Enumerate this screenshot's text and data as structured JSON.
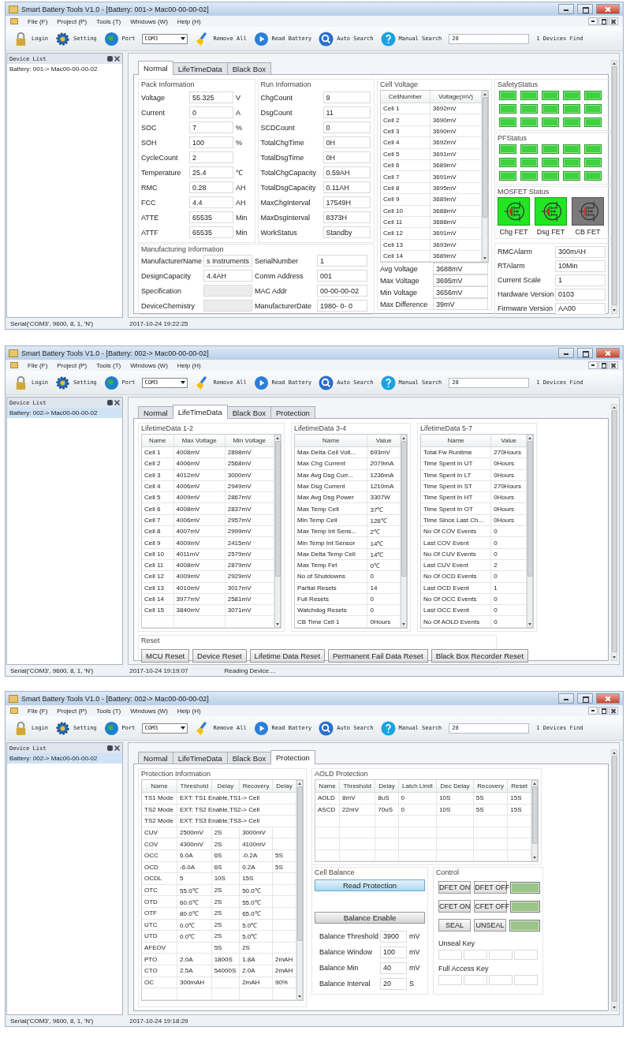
{
  "windows": [
    {
      "title": "Smart Battery Tools V1.0 - [Battery: 001-> Mac00-00-00-02]",
      "menu": [
        "File (F)",
        "Project (P)",
        "Tools (T)",
        "Windows (W)",
        "Help (H)"
      ],
      "toolbar": [
        {
          "kind": "button",
          "label": "Login"
        },
        {
          "kind": "button",
          "label": "Setting"
        },
        {
          "kind": "button",
          "label": "Port"
        },
        {
          "kind": "combo",
          "value": "COM3"
        },
        {
          "kind": "button",
          "label": "Remove All"
        },
        {
          "kind": "button",
          "label": "Read Battery"
        },
        {
          "kind": "button",
          "label": "Auto Search"
        },
        {
          "kind": "button",
          "label": "Manual Search"
        },
        {
          "kind": "field",
          "value": "28"
        },
        {
          "kind": "text",
          "label": "1 Devices Find"
        }
      ],
      "device_list": {
        "title": "Device List",
        "items": [
          {
            "label": "Battery: 001-> Mac00-00-00-02",
            "selected": false
          }
        ]
      },
      "tabs": [
        {
          "label": "Normal",
          "selected": true
        },
        {
          "label": "LifeTimeData",
          "selected": false
        },
        {
          "label": "Black Box",
          "selected": false
        }
      ],
      "page": {
        "kind": "normal",
        "pack_information": {
          "title": "Pack Information",
          "rows": [
            {
              "label": "Voltage",
              "value": "55.325",
              "unit": "V"
            },
            {
              "label": "Current",
              "value": "0",
              "unit": "A"
            },
            {
              "label": "SOC",
              "value": "7",
              "unit": "%"
            },
            {
              "label": "SOH",
              "value": "100",
              "unit": "%"
            },
            {
              "label": "CycleCount",
              "value": "2"
            },
            {
              "label": "Temperature",
              "value": "25.4",
              "unit": "℃"
            },
            {
              "label": "RMC",
              "value": "0.28",
              "unit": "AH"
            },
            {
              "label": "FCC",
              "value": "4.4",
              "unit": "AH"
            },
            {
              "label": "ATTE",
              "value": "65535",
              "unit": "Min"
            },
            {
              "label": "ATTF",
              "value": "65535",
              "unit": "Min"
            }
          ]
        },
        "run_information": {
          "title": "Run Information",
          "rows": [
            {
              "label": "ChgCount",
              "value": "9"
            },
            {
              "label": "DsgCount",
              "value": "11"
            },
            {
              "label": "SCDCount",
              "value": "0"
            },
            {
              "label": "TotalChgTime",
              "value": "0H"
            },
            {
              "label": "TotalDsgTime",
              "value": "0H"
            },
            {
              "label": "TotalChgCapacity",
              "value": "0.59AH"
            },
            {
              "label": "TotalDsgCapacity",
              "value": "0.11AH"
            },
            {
              "label": "MaxChgInterval",
              "value": "17549H"
            },
            {
              "label": "MaxDsgInterval",
              "value": "8373H"
            },
            {
              "label": "WorkStatus",
              "value": "Standby"
            }
          ]
        },
        "manufacturing_information": {
          "title": "Manufacturing Information",
          "rows": [
            {
              "left": {
                "label": "ManufacturerName",
                "value": "s Instruments",
                "disabled": false
              },
              "right": {
                "label": "SerialNumber",
                "value": "1",
                "disabled": false
              }
            },
            {
              "left": {
                "label": "DesignCapacity",
                "value": "4.4AH",
                "disabled": false
              },
              "right": {
                "label": "Comm Address",
                "value": "001",
                "disabled": false
              }
            },
            {
              "left": {
                "label": "Specification",
                "disabled": true
              },
              "right": {
                "label": "MAC Addr",
                "value": "00-00-00-02",
                "disabled": false
              }
            },
            {
              "left": {
                "label": "DeviceChemistry",
                "disabled": true
              },
              "right": {
                "label": "ManufacturerDate",
                "value": "1980- 0- 0",
                "disabled": false
              }
            }
          ]
        },
        "cell_voltage": {
          "title": "Cell Voltage",
          "columns": [
            "CellNumber",
            "Voltage(mV)"
          ],
          "rows": [
            [
              "Cell 1",
              "3692mV"
            ],
            [
              "Cell 2",
              "3690mV"
            ],
            [
              "Cell 3",
              "3690mV"
            ],
            [
              "Cell 4",
              "3692mV"
            ],
            [
              "Cell 5",
              "3691mV"
            ],
            [
              "Cell 6",
              "3689mV"
            ],
            [
              "Cell 7",
              "3691mV"
            ],
            [
              "Cell 8",
              "3695mV"
            ],
            [
              "Cell 9",
              "3689mV"
            ],
            [
              "Cell 10",
              "3688mV"
            ],
            [
              "Cell 11",
              "3688mV"
            ],
            [
              "Cell 12",
              "3691mV"
            ],
            [
              "Cell 13",
              "3693mV"
            ],
            [
              "Cell 14",
              "3689mV"
            ]
          ],
          "summary": [
            {
              "label": "Avg Voltage",
              "value": "3688mV"
            },
            {
              "label": "Max Voltage",
              "value": "3695mV"
            },
            {
              "label": "Min Voltage",
              "value": "3656mV"
            },
            {
              "label": "Max Difference",
              "value": "39mV"
            }
          ]
        },
        "safety_status": {
          "title": "SafetyStatus",
          "indicators": [
            {
              "on": true
            },
            {
              "on": true
            },
            {
              "on": true
            },
            {
              "on": true
            },
            {
              "on": true
            },
            {
              "on": true
            },
            {
              "on": true
            },
            {
              "on": true
            },
            {
              "on": true
            },
            {
              "on": true
            },
            {
              "on": true
            },
            {
              "on": true
            },
            {
              "on": true
            },
            {
              "on": true
            },
            {
              "on": true
            }
          ]
        },
        "pf_status": {
          "title": "PFStatus",
          "indicators": [
            {
              "on": true
            },
            {
              "on": true
            },
            {
              "on": true
            },
            {
              "on": true
            },
            {
              "on": true
            },
            {
              "on": true
            },
            {
              "on": true
            },
            {
              "on": true
            },
            {
              "on": true
            },
            {
              "on": true
            },
            {
              "on": true
            },
            {
              "on": true
            },
            {
              "on": true
            },
            {
              "on": true
            },
            {
              "on": true
            }
          ]
        },
        "mosfet_status": {
          "title": "MOSFET Status",
          "fets": [
            {
              "label": "Chg FET",
              "on": true
            },
            {
              "label": "Dsg FET",
              "on": true
            },
            {
              "label": "CB FET",
              "on": false
            }
          ]
        },
        "alarms": [
          {
            "label": "RMCAlarm",
            "value": "300mAH"
          },
          {
            "label": "RTAlarm",
            "value": "10Min"
          },
          {
            "label": "Current Scale",
            "value": "1"
          },
          {
            "label": "Hardware Version",
            "value": "0103"
          },
          {
            "label": "Firmware Version",
            "value": "AA00"
          }
        ]
      },
      "status_bar": [
        "Serial('COM3', 9600, 8, 1, 'N')",
        "2017-10-24 19:22:25"
      ]
    },
    {
      "title": "Smart Battery Tools V1.0 - [Battery: 002-> Mac00-00-00-02]",
      "menu": [
        "File (F)",
        "Project (P)",
        "Tools (T)",
        "Windows (W)",
        "Help (H)"
      ],
      "toolbar": [
        {
          "kind": "button",
          "label": "Login"
        },
        {
          "kind": "button",
          "label": "Setting"
        },
        {
          "kind": "button",
          "label": "Port"
        },
        {
          "kind": "combo",
          "value": "COM3"
        },
        {
          "kind": "button",
          "label": "Remove All"
        },
        {
          "kind": "button",
          "label": "Read Battery"
        },
        {
          "kind": "button",
          "label": "Auto Search"
        },
        {
          "kind": "button",
          "label": "Manual Search"
        },
        {
          "kind": "field",
          "value": "28"
        },
        {
          "kind": "text",
          "label": "1 Devices Find"
        }
      ],
      "device_list": {
        "title": "Device List",
        "items": [
          {
            "label": "Battery: 002-> Mac00-00-00-02",
            "selected": true
          }
        ]
      },
      "tabs": [
        {
          "label": "Normal",
          "selected": false
        },
        {
          "label": "LifeTimeData",
          "selected": true
        },
        {
          "label": "Black Box",
          "selected": false
        },
        {
          "label": "Protection",
          "selected": false
        }
      ],
      "page": {
        "kind": "lifetime",
        "tables": [
          {
            "title": "LifetimeData 1-2",
            "columns": [
              "Name",
              "Max Voltage",
              "Min Voltage"
            ],
            "rows": [
              [
                "Cell 1",
                "4008mV",
                "2898mV"
              ],
              [
                "Cell 2",
                "4006mV",
                "2568mV"
              ],
              [
                "Cell 3",
                "4012mV",
                "3000mV"
              ],
              [
                "Cell 4",
                "4006mV",
                "2949mV"
              ],
              [
                "Cell 5",
                "4009mV",
                "2867mV"
              ],
              [
                "Cell 6",
                "4008mV",
                "2837mV"
              ],
              [
                "Cell 7",
                "4006mV",
                "2957mV"
              ],
              [
                "Cell 8",
                "4007mV",
                "2999mV"
              ],
              [
                "Cell 9",
                "4009mV",
                "2415mV"
              ],
              [
                "Cell 10",
                "4011mV",
                "2579mV"
              ],
              [
                "Cell 11",
                "4008mV",
                "2879mV"
              ],
              [
                "Cell 12",
                "4009mV",
                "2929mV"
              ],
              [
                "Cell 13",
                "4010mV",
                "3017mV"
              ],
              [
                "Cell 14",
                "3977mV",
                "2581mV"
              ],
              [
                "Cell 15",
                "3840mV",
                "3071mV"
              ]
            ]
          },
          {
            "title": "LifetimeData 3-4",
            "columns": [
              "Name",
              "Value"
            ],
            "rows": [
              [
                "Max Delta Cell Volt...",
                "693mV"
              ],
              [
                "Max Chg Current",
                "2079mA"
              ],
              [
                "Max Avg Dsg Curr...",
                "1236mA"
              ],
              [
                "Max Dsg Current",
                "1210mA"
              ],
              [
                "Max Avg Dsg Power",
                "3307W"
              ],
              [
                "Max Temp Cell",
                "37℃"
              ],
              [
                "Min Temp Cell",
                "128℃"
              ],
              [
                "Max Temp Int Sens...",
                "2℃"
              ],
              [
                "Min Temp Int Sensor",
                "14℃"
              ],
              [
                "Max Delta Temp Cell",
                "14℃"
              ],
              [
                "Max Temp Fet",
                "0℃"
              ],
              [
                "No of Shutdowns",
                "0"
              ],
              [
                "Partial Resets",
                "14"
              ],
              [
                "Full Resets",
                "0"
              ],
              [
                "Watchdog Resets",
                "0"
              ],
              [
                "CB Time Cell 1",
                "0Hours"
              ]
            ]
          },
          {
            "title": "LifetimeData 5-7",
            "columns": [
              "Name",
              "Value"
            ],
            "rows": [
              [
                "Total Fw Runtime",
                "270Hours"
              ],
              [
                "Time Spent In UT",
                "0Hours"
              ],
              [
                "Time Spent In LT",
                "0Hours"
              ],
              [
                "Time Spent In ST",
                "270Hours"
              ],
              [
                "Time Spent In HT",
                "0Hours"
              ],
              [
                "Time Spent In OT",
                "0Hours"
              ],
              [
                "Time Since Last Ch...",
                "0Hours"
              ],
              [
                "No Of COV Events",
                "0"
              ],
              [
                "Last COV Event",
                "0"
              ],
              [
                "No Of CUV Events",
                "0"
              ],
              [
                "Last CUV Event",
                "2"
              ],
              [
                "No Of OCD Events",
                "0"
              ],
              [
                "Last OCD Event",
                "1"
              ],
              [
                "No Of OCC Events",
                "0"
              ],
              [
                "Last OCC Event",
                "0"
              ],
              [
                "No Of AOLD Events",
                "0"
              ]
            ]
          }
        ],
        "reset": {
          "title": "Reset",
          "buttons": [
            "MCU Reset",
            "Device Reset",
            "Lifetime Data Reset",
            "Permanent Fail Data Reset",
            "Black Box Recorder Reset"
          ]
        }
      },
      "status_bar": [
        "Serial('COM3', 9600, 8, 1, 'N')",
        "2017-10-24 19:19:07",
        "Reading Device...."
      ]
    },
    {
      "title": "Smart Battery Tools V1.0 - [Battery: 002-> Mac00-00-00-02]",
      "menu": [
        "File (F)",
        "Project (P)",
        "Tools (T)",
        "Windows (W)",
        "Help (H)"
      ],
      "toolbar": [
        {
          "kind": "button",
          "label": "Login"
        },
        {
          "kind": "button",
          "label": "Setting"
        },
        {
          "kind": "button",
          "label": "Port"
        },
        {
          "kind": "combo",
          "value": "COM3"
        },
        {
          "kind": "button",
          "label": "Remove All"
        },
        {
          "kind": "button",
          "label": "Read Battery"
        },
        {
          "kind": "button",
          "label": "Auto Search"
        },
        {
          "kind": "button",
          "label": "Manual Search"
        },
        {
          "kind": "field",
          "value": "28"
        },
        {
          "kind": "text",
          "label": "1 Devices Find"
        }
      ],
      "device_list": {
        "title": "Device List",
        "items": [
          {
            "label": "Battery: 002-> Mac00-00-00-02",
            "selected": true
          }
        ]
      },
      "tabs": [
        {
          "label": "Normal",
          "selected": false
        },
        {
          "label": "LifeTimeData",
          "selected": false
        },
        {
          "label": "Black Box",
          "selected": false
        },
        {
          "label": "Protection",
          "selected": true
        }
      ],
      "page": {
        "kind": "protection",
        "protection_information": {
          "title": "Protection Information",
          "columns": [
            "Name",
            "Threshold",
            "Delay",
            "Recovery",
            "Delay"
          ],
          "rows": [
            [
              "TS1 Mode",
              {
                "text": "EXT: TS1 Enable,TS1-> Cell",
                "colspan": 4
              }
            ],
            [
              "TS2 Mode",
              {
                "text": "EXT: TS2 Enable,TS2-> Cell",
                "colspan": 4
              }
            ],
            [
              "TS2 Mode",
              {
                "text": "EXT: TS3 Enable,TS3-> Cell",
                "colspan": 4
              }
            ],
            [
              "CUV",
              "2500mV",
              "2S",
              "3000mV",
              null
            ],
            [
              "COV",
              "4300mV",
              "2S",
              "4100mV",
              null
            ],
            [
              "OCC",
              "6.0A",
              "6S",
              "-0.2A",
              "5S"
            ],
            [
              "OCD",
              "-6.0A",
              "6S",
              "0.2A",
              "5S"
            ],
            [
              "OCDL",
              "5",
              "10S",
              "15S",
              null
            ],
            [
              "OTC",
              "55.0℃",
              "2S",
              "50.0℃",
              null
            ],
            [
              "OTD",
              "60.0℃",
              "2S",
              "55.0℃",
              null
            ],
            [
              "OTF",
              "80.0℃",
              "2S",
              "65.0℃",
              null
            ],
            [
              "UTC",
              "0.0℃",
              "2S",
              "5.0℃",
              null
            ],
            [
              "UTD",
              "0.0℃",
              "2S",
              "5.0℃",
              null
            ],
            [
              "AFEOV",
              null,
              "5S",
              "2S",
              null
            ],
            [
              "PTO",
              "2.0A",
              "1800S",
              "1.8A",
              "2mAH"
            ],
            [
              "CTO",
              "2.5A",
              "54000S",
              "2.0A",
              "2mAH"
            ],
            [
              "OC",
              "300mAH",
              null,
              "2mAH",
              "90%"
            ]
          ]
        },
        "aold_protection": {
          "title": "AOLD Protection",
          "columns": [
            "Name",
            "Threshold",
            "Delay",
            "Latch Limit",
            "Dec Delay",
            "Recovery",
            "Reset"
          ],
          "rows": [
            [
              "AOLD",
              "8mV",
              "8uS",
              "0",
              "10S",
              "5S",
              "15S"
            ],
            [
              "ASCD",
              "22mV",
              "70uS",
              "0",
              "10S",
              "5S",
              "15S"
            ]
          ]
        },
        "cell_balance": {
          "title": "Cell Balance",
          "buttons": [
            {
              "label": "Read Protection",
              "highlighted": true
            },
            {
              "label": "Balance Enable",
              "highlighted": false
            }
          ],
          "fields": [
            {
              "label": "Balance Threshold",
              "value": "3900",
              "unit": "mV"
            },
            {
              "label": "Balance Window",
              "value": "100",
              "unit": "mV"
            },
            {
              "label": "Balance Min",
              "value": "40",
              "unit": "mV"
            },
            {
              "label": "Balance Interval",
              "value": "20",
              "unit": "S"
            }
          ]
        },
        "control": {
          "title": "Control",
          "rows": [
            {
              "on_label": "DFET ON",
              "off_label": "DFET OFF",
              "on": true
            },
            {
              "on_label": "CFET ON",
              "off_label": "CFET OFF",
              "on": true
            },
            {
              "on_label": "SEAL",
              "off_label": "UNSEAL",
              "on": true
            }
          ],
          "keys": [
            "Unseal Key",
            "Full Access Key"
          ]
        }
      },
      "status_bar": [
        "Serial('COM3', 9600, 8, 1, 'N')",
        "2017-10-24 19:18:29"
      ]
    }
  ]
}
